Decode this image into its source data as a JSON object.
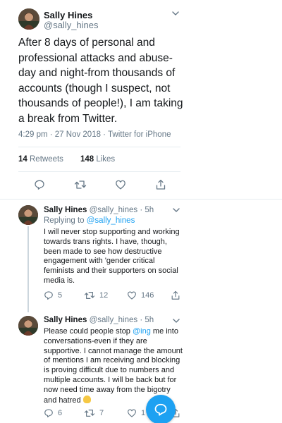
{
  "main_tweet": {
    "author_name": "Sally Hines",
    "author_handle": "@sally_hines",
    "text": "After 8 days of personal and professional attacks and abuse-day and night-from thousands of accounts (though I suspect, not thousands of people!), I am taking a break from Twitter.",
    "timestamp": "4:29 pm · 27 Nov 2018 · Twitter for iPhone",
    "retweets_count": "14",
    "retweets_label": "Retweets",
    "likes_count": "148",
    "likes_label": "Likes"
  },
  "replies": [
    {
      "author_name": "Sally Hines",
      "author_handle": "@sally_hines",
      "age": "· 5h",
      "replying_prefix": "Replying to",
      "replying_mention": "@sally_hines",
      "text": "I will never stop supporting and working towards trans rights. I have, though, been made to see how destructive engagement with 'gender critical feminists and their supporters on social media is.",
      "reply_count": "5",
      "retweet_count": "12",
      "like_count": "146"
    },
    {
      "author_name": "Sally Hines",
      "author_handle": "@sally_hines",
      "age": "· 5h",
      "text_before": "Please could people stop ",
      "text_mention": "@ing",
      "text_after": " me into conversations-even if they are supportive. I cannot manage the amount of mentions I am receiving and blocking is proving difficult due to numbers and multiple accounts. I will be back but for now need time away from the bigotry and hatred",
      "reply_count": "6",
      "retweet_count": "7",
      "like_count": "1"
    }
  ],
  "icons": {
    "reply": "reply-icon",
    "retweet": "retweet-icon",
    "like": "heart-icon",
    "share": "share-icon",
    "compose": "compose-icon"
  },
  "colors": {
    "accent": "#1da1f2",
    "muted": "#657786",
    "text": "#14171a",
    "divider": "#e6ecf0",
    "thread_line": "#ccd6dd"
  }
}
